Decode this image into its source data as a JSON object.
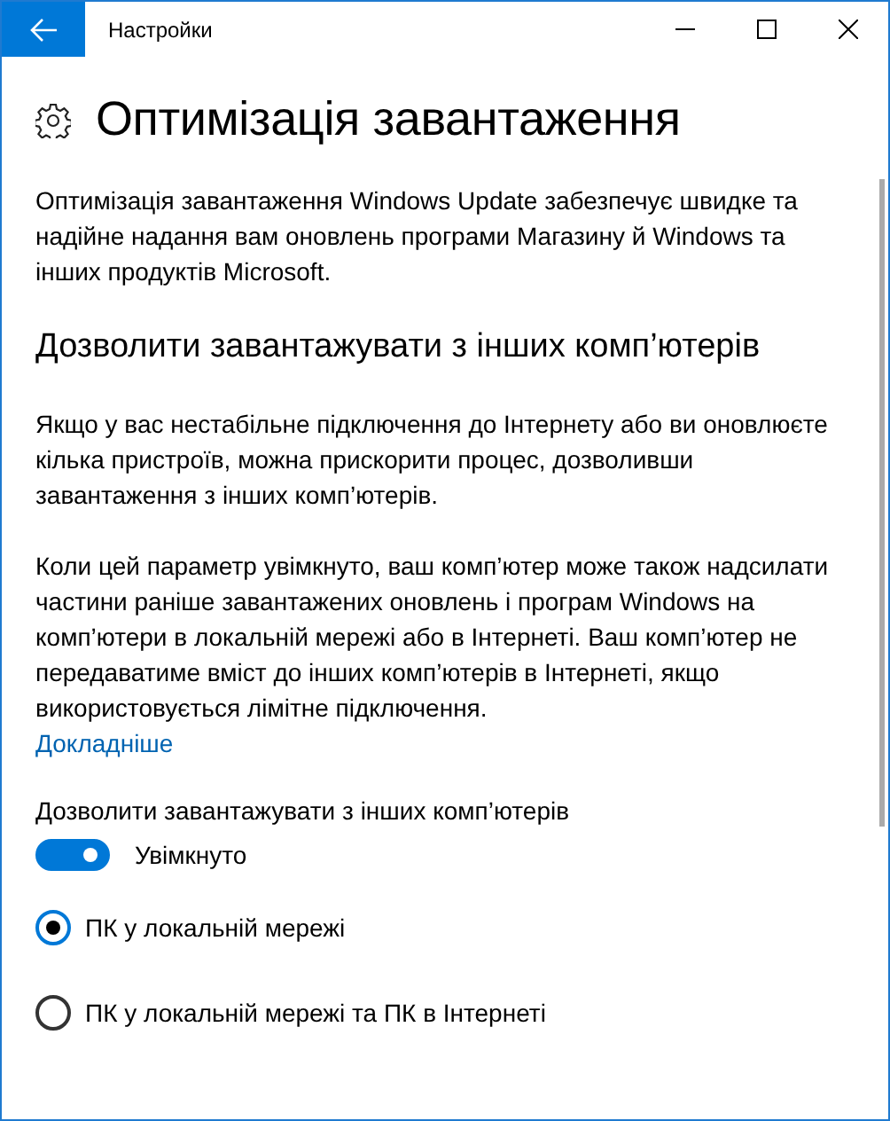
{
  "window": {
    "title": "Настройки"
  },
  "page": {
    "title": "Оптимізація завантаження",
    "intro": "Оптимізація завантаження Windows Update забезпечує швидке та надійне надання вам оновлень програми Магазину й Windows та інших продуктів Microsoft."
  },
  "section": {
    "title": "Дозволити завантажувати з інших комп’ютерів",
    "paragraphs": [
      "Якщо у вас нестабільне підключення до Інтернету або ви оновлюєте кілька пристроїв, можна прискорити процес, дозволивши завантаження з інших комп’ютерів.",
      "Коли цей параметр увімкнуто, ваш комп’ютер може також надсилати частини раніше завантажених оновлень і програм Windows на комп’ютери в локальній мережі або в Інтернеті. Ваш комп’ютер не передаватиме вміст до інших комп’ютерів в Інтернеті, якщо використовується лімітне підключення."
    ],
    "link": "Докладніше"
  },
  "toggle": {
    "label": "Дозволити завантажувати з інших комп’ютерів",
    "on": true,
    "state_text": "Увімкнуто"
  },
  "radios": [
    {
      "label": "ПК у локальній мережі",
      "selected": true
    },
    {
      "label": "ПК у локальній мережі та ПК в Інтернеті",
      "selected": false
    }
  ]
}
